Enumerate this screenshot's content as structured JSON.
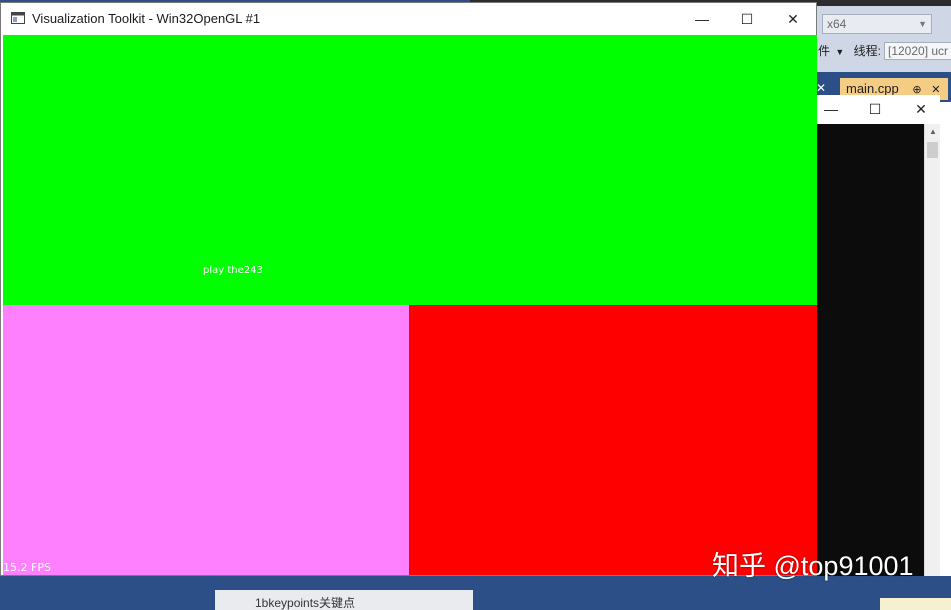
{
  "vtk_window": {
    "title": "Visualization Toolkit - Win32OpenGL #1",
    "overlay_text": "play the243",
    "fps": "15.2 FPS",
    "viewport_colors": {
      "top": "#00ff00",
      "bottom_left": "#ff80ff",
      "bottom_right": "#ff0000"
    },
    "controls": {
      "minimize": "—",
      "maximize": "☐",
      "close": "✕"
    }
  },
  "console_window": {
    "controls": {
      "minimize": "—",
      "maximize": "☐",
      "close": "✕"
    }
  },
  "ide": {
    "platform_select": "x64",
    "events_label": "件",
    "thread_label": "线程:",
    "thread_value": "[12020] ucr",
    "tab_close": "✕",
    "active_tab": "main.cpp",
    "active_tab_pin": "⊕",
    "active_tab_close": "✕",
    "bottom_item": "1bkeypoints关键点"
  },
  "watermark": "知乎 @top91001"
}
